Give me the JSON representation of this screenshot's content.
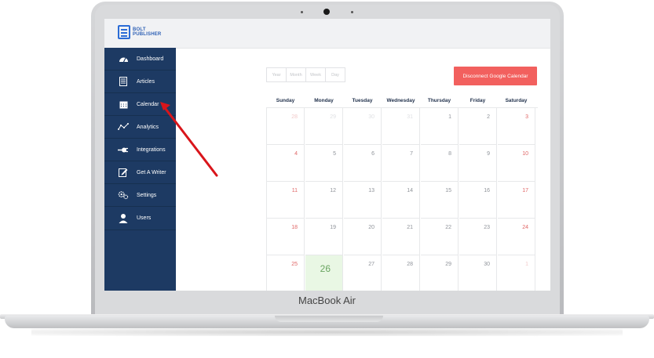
{
  "device": {
    "brand_label": "MacBook Air"
  },
  "app": {
    "logo_line1": "BOLT",
    "logo_line2": "PUBLISHER",
    "accent": "#1d3a63",
    "danger": "#f2605e"
  },
  "sidebar": {
    "items": [
      {
        "label": "Dashboard",
        "icon": "speedometer-icon"
      },
      {
        "label": "Articles",
        "icon": "document-icon"
      },
      {
        "label": "Calendar",
        "icon": "calendar-icon"
      },
      {
        "label": "Analytics",
        "icon": "line-graph-icon"
      },
      {
        "label": "Integrations",
        "icon": "plug-icon"
      },
      {
        "label": "Get A Writer",
        "icon": "edit-icon"
      },
      {
        "label": "Settings",
        "icon": "gears-icon"
      },
      {
        "label": "Users",
        "icon": "user-icon"
      }
    ]
  },
  "calendar": {
    "views": [
      "Year",
      "Month",
      "Week",
      "Day"
    ],
    "disconnect_label": "Disconnect Google Calendar",
    "weekdays": [
      "Sunday",
      "Monday",
      "Tuesday",
      "Wednesday",
      "Thursday",
      "Friday",
      "Saturday"
    ],
    "weeks": [
      [
        "28",
        "29",
        "30",
        "31",
        "1",
        "2",
        "3"
      ],
      [
        "4",
        "5",
        "6",
        "7",
        "8",
        "9",
        "10"
      ],
      [
        "11",
        "12",
        "13",
        "14",
        "15",
        "16",
        "17"
      ],
      [
        "18",
        "19",
        "20",
        "21",
        "22",
        "23",
        "24"
      ],
      [
        "25",
        "26",
        "27",
        "28",
        "29",
        "30",
        "1"
      ]
    ],
    "today": "26"
  }
}
